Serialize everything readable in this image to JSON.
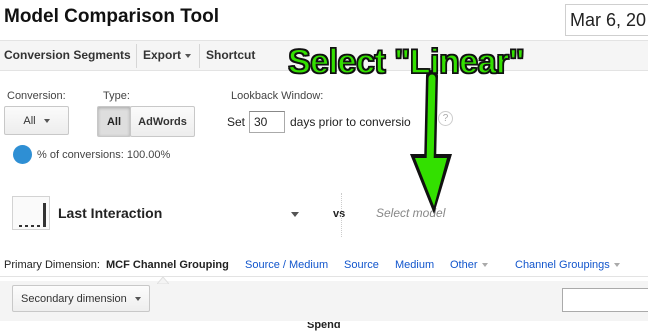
{
  "header": {
    "title": "Model Comparison Tool",
    "date_range": "Mar 6, 20"
  },
  "toolbar": {
    "conversion_segments_label": "Conversion Segments",
    "export_label": "Export",
    "shortcut_label": "Shortcut"
  },
  "filters": {
    "conversion_label": "Conversion:",
    "conversion_value": "All",
    "type_label": "Type:",
    "type_all_label": "All",
    "type_adwords_label": "AdWords",
    "lookback_label": "Lookback Window:",
    "set_label": "Set",
    "days_value": "30",
    "days_suffix": "days prior to conversio",
    "help_glyph": "?",
    "percent_text": "% of conversions: 100.00%"
  },
  "models": {
    "primary_model": "Last Interaction",
    "vs_label": "vs",
    "select_model_placeholder": "Select model"
  },
  "dimensions": {
    "label": "Primary Dimension:",
    "items": [
      {
        "label": "MCF Channel Grouping",
        "active": true
      },
      {
        "label": "Source / Medium",
        "active": false
      },
      {
        "label": "Source",
        "active": false
      },
      {
        "label": "Medium",
        "active": false
      },
      {
        "label": "Other",
        "active": false
      },
      {
        "label": "Channel Groupings",
        "active": false
      }
    ]
  },
  "secondary": {
    "button_label": "Secondary dimension"
  },
  "table": {
    "partial_column_header": "Spend"
  },
  "annotation": {
    "text": "Select \"Linear\"",
    "color": "#33e000"
  },
  "colors": {
    "link": "#1155cc",
    "pie_icon": "#2e8fd4",
    "toolbar_bg": "#f5f5f5"
  }
}
